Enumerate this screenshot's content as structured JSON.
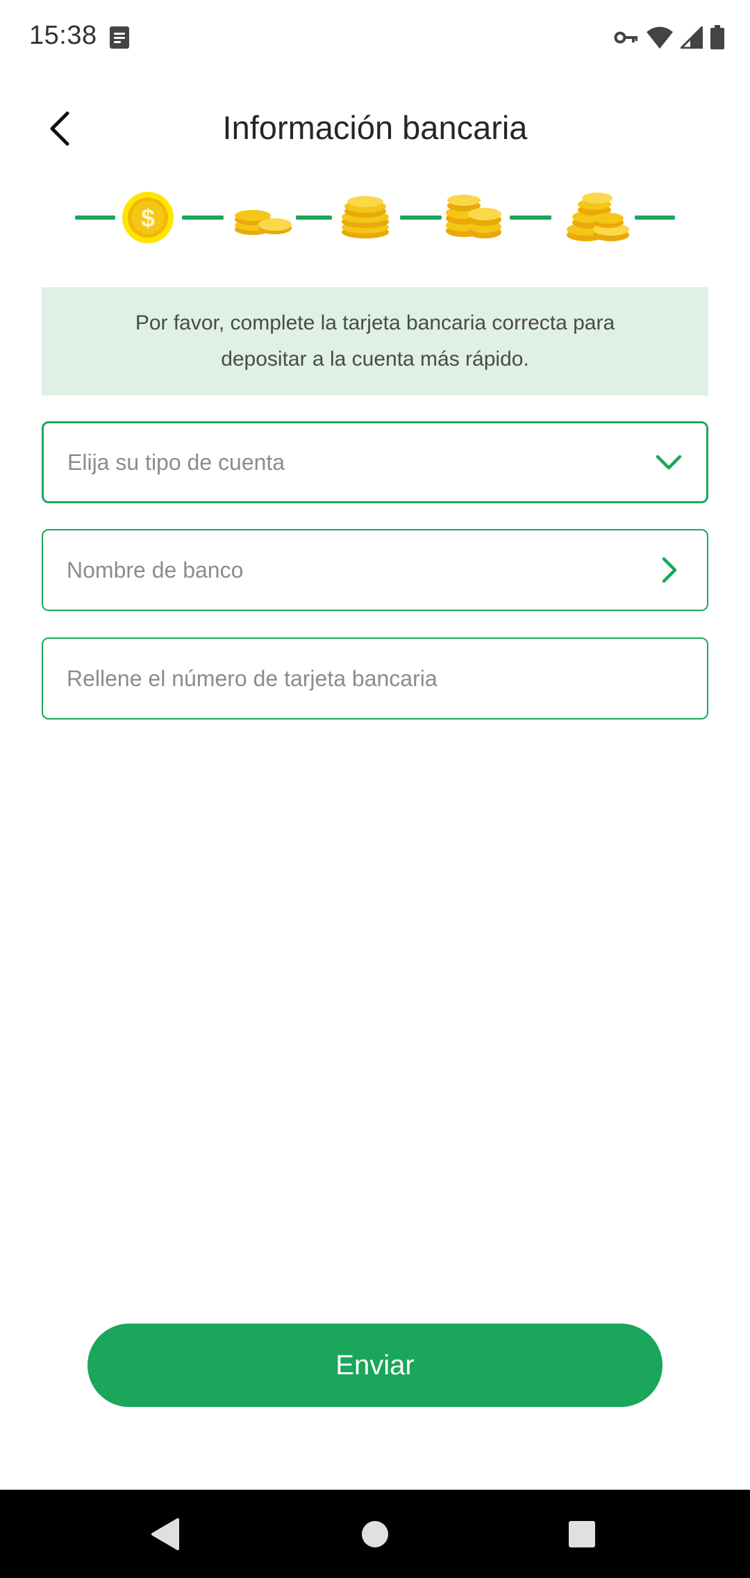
{
  "status_bar": {
    "time": "15:38",
    "icons": [
      "notes-icon",
      "vpn-key-icon",
      "wifi-icon",
      "cell-signal-icon",
      "battery-icon"
    ]
  },
  "header": {
    "title": "Información bancaria",
    "back_icon": "chevron-left-icon"
  },
  "progress": {
    "current_step": 1,
    "total_steps": 6,
    "step_icons": [
      "dollar-coin-icon",
      "small-coin-stack-icon",
      "coin-stack-icon",
      "double-coin-stack-icon",
      "large-coin-pile-icon"
    ]
  },
  "banner": {
    "text": "Por favor, complete la tarjeta bancaria correcta para depositar a la cuenta más rápido."
  },
  "form": {
    "account_type": {
      "placeholder": "Elija su tipo de cuenta",
      "icon": "chevron-down-icon"
    },
    "bank_name": {
      "placeholder": "Nombre de banco",
      "icon": "chevron-right-icon"
    },
    "card_number": {
      "placeholder": "Rellene el número de tarjeta bancaria"
    }
  },
  "submit": {
    "label": "Enviar"
  },
  "colors": {
    "accent": "#1aa65b",
    "banner_bg": "#dff0e5",
    "coin": "#f5c518"
  },
  "nav_bar": {
    "icons": [
      "nav-back-icon",
      "nav-home-icon",
      "nav-recent-icon"
    ]
  }
}
